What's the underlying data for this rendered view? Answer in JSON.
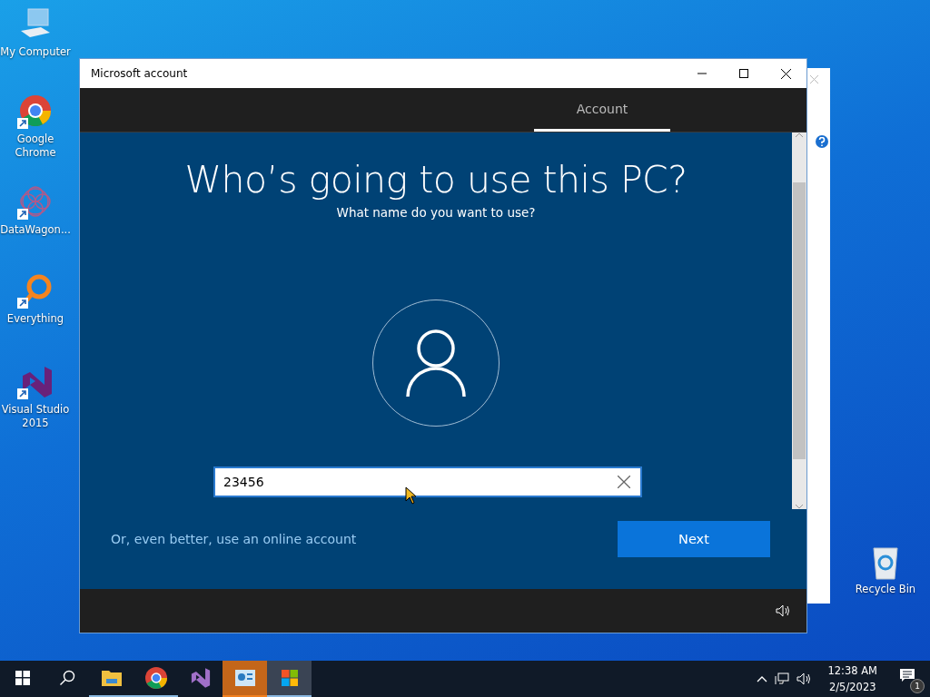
{
  "desktop_icons": [
    {
      "kind": "computer",
      "label": "My Computer",
      "shortcut": false
    },
    {
      "kind": "chrome",
      "label": "Google Chrome",
      "shortcut": true
    },
    {
      "kind": "datawagon",
      "label": "DataWagon...",
      "shortcut": true
    },
    {
      "kind": "everything",
      "label": "Everything",
      "shortcut": true
    },
    {
      "kind": "vs",
      "label": "Visual Studio 2015",
      "shortcut": true
    },
    {
      "kind": "recycle",
      "label": "Recycle Bin",
      "shortcut": false
    }
  ],
  "window": {
    "title": "Microsoft account",
    "tabs": [
      {
        "label": "Account",
        "selected": true
      }
    ],
    "heading": "Who’s going to use this PC?",
    "subheading": "What name do you want to use?",
    "name_field": {
      "value": "23456"
    },
    "link": "Or, even better, use an online account",
    "next_button": "Next"
  },
  "taskbar": {
    "items": [
      {
        "kind": "start",
        "running": false,
        "flashing": false,
        "selected": false
      },
      {
        "kind": "search",
        "running": false,
        "flashing": false,
        "selected": false
      },
      {
        "kind": "explorer",
        "running": true,
        "flashing": false,
        "selected": false
      },
      {
        "kind": "chrome",
        "running": true,
        "flashing": false,
        "selected": false
      },
      {
        "kind": "vs",
        "running": false,
        "flashing": false,
        "selected": false
      },
      {
        "kind": "app",
        "running": true,
        "flashing": true,
        "selected": false
      },
      {
        "kind": "store",
        "running": true,
        "flashing": false,
        "selected": true
      }
    ],
    "time": "12:38 AM",
    "date": "2/5/2023",
    "notification_count": "1"
  }
}
